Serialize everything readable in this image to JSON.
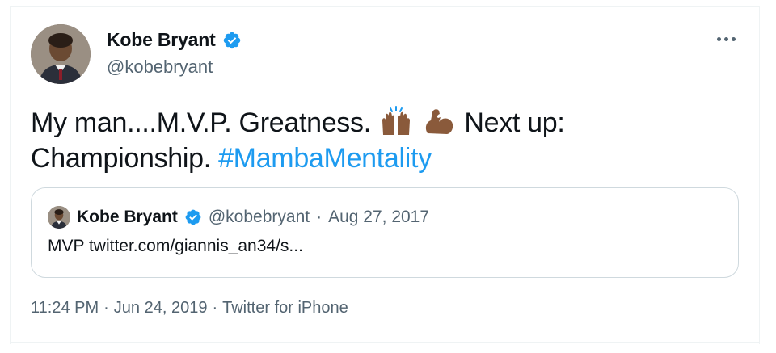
{
  "author": {
    "name": "Kobe Bryant",
    "handle": "@kobebryant",
    "verified": true,
    "avatar": "child-portrait-avatar"
  },
  "tweet": {
    "text_part1": "My man....M.V.P. Greatness.",
    "emojis": [
      "raising-hands-emoji",
      "flexed-biceps-emoji"
    ],
    "text_part2": "Next up:",
    "text_line2": "Championship.",
    "hashtag": "#MambaMentality"
  },
  "quote": {
    "name": "Kobe Bryant",
    "handle": "@kobebryant",
    "separator": "·",
    "date": "Aug 27, 2017",
    "body": "MVP twitter.com/giannis_an34/s..."
  },
  "meta": {
    "time": "11:24 PM",
    "sep1": "·",
    "date": "Jun 24, 2019",
    "sep2": "·",
    "source": "Twitter for iPhone"
  },
  "colors": {
    "accent": "#1d9bf0",
    "secondary_text": "#536471",
    "border": "#cfd9de"
  },
  "icons": {
    "verified": "verified-badge-icon",
    "more": "more-options-icon"
  }
}
